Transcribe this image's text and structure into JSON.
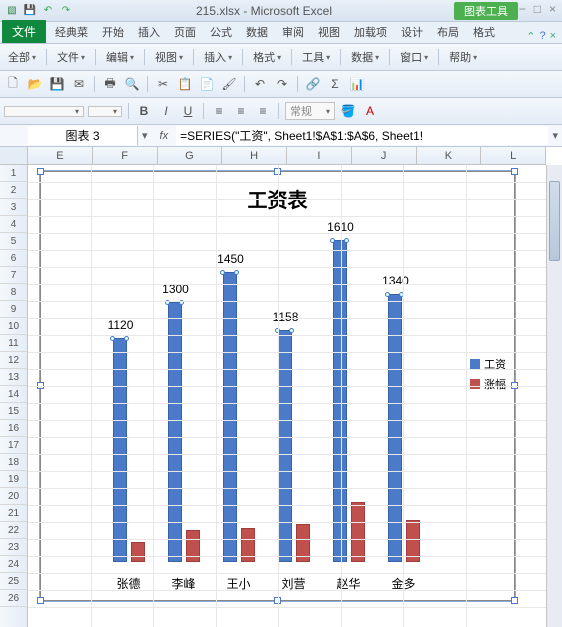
{
  "titlebar": {
    "title": "215.xlsx - Microsoft Excel",
    "chart_tools": "图表工具"
  },
  "tabs": {
    "file": "文件",
    "items": [
      "经典菜",
      "开始",
      "插入",
      "页面",
      "公式",
      "数据",
      "审阅",
      "视图",
      "加载项",
      "设计",
      "布局",
      "格式"
    ]
  },
  "toolbar_row1": {
    "all": "全部",
    "file": "文件",
    "edit": "编辑",
    "view": "视图",
    "insert": "插入",
    "format": "格式",
    "tools": "工具",
    "data": "数据",
    "window": "窗口",
    "help": "帮助"
  },
  "formula": {
    "name": "图表 3",
    "fx": "fx",
    "value": "=SERIES(\"工资\", Sheet1!$A$1:$A$6, Sheet1!"
  },
  "columns": [
    "E",
    "F",
    "G",
    "H",
    "I",
    "J",
    "K",
    "L"
  ],
  "chart_data": {
    "type": "bar",
    "title": "工资表",
    "categories": [
      "张德",
      "李峰",
      "王小",
      "刘营",
      "赵华",
      "金多"
    ],
    "series": [
      {
        "name": "工资",
        "color": "#4a7ac8",
        "values": [
          1120,
          1300,
          1450,
          1158,
          1610,
          1340
        ]
      },
      {
        "name": "涨幅",
        "color": "#c0504d",
        "values": [
          100,
          160,
          170,
          190,
          300,
          210
        ]
      }
    ],
    "ylim": [
      0,
      1700
    ]
  }
}
